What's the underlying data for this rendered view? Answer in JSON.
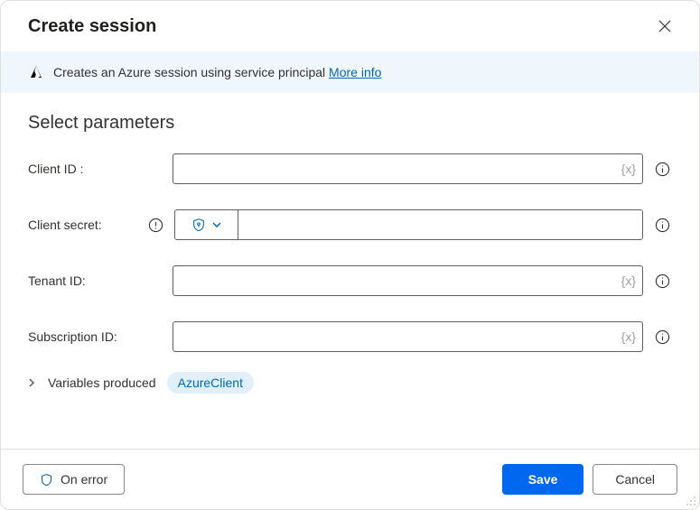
{
  "header": {
    "title": "Create session"
  },
  "banner": {
    "text": "Creates an Azure session using service principal ",
    "link_text": "More info"
  },
  "section": {
    "title": "Select parameters"
  },
  "fields": {
    "client_id": {
      "label": "Client ID :",
      "value": "",
      "var_hint": "{x}"
    },
    "client_secret": {
      "label": "Client secret:",
      "value": ""
    },
    "tenant_id": {
      "label": "Tenant ID:",
      "value": "",
      "var_hint": "{x}"
    },
    "subscription_id": {
      "label": "Subscription ID:",
      "value": "",
      "var_hint": "{x}"
    }
  },
  "variables": {
    "label": "Variables produced",
    "chip": "AzureClient"
  },
  "footer": {
    "on_error": "On error",
    "save": "Save",
    "cancel": "Cancel"
  }
}
